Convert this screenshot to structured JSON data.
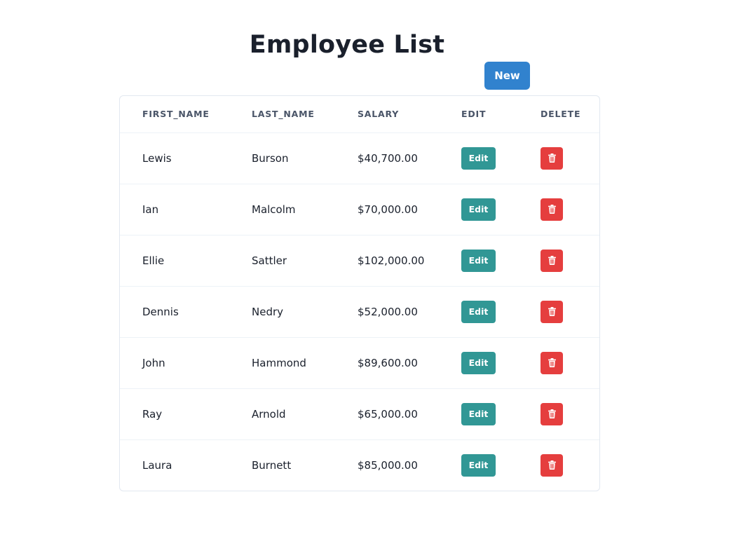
{
  "page": {
    "title": "Employee List",
    "new_label": "New"
  },
  "table": {
    "headers": [
      "FIRST_NAME",
      "LAST_NAME",
      "SALARY",
      "EDIT",
      "DELETE"
    ],
    "edit_label": "Edit",
    "delete_icon": "trash-icon",
    "rows": [
      {
        "first_name": "Lewis",
        "last_name": "Burson",
        "salary": "$40,700.00"
      },
      {
        "first_name": "Ian",
        "last_name": "Malcolm",
        "salary": "$70,000.00"
      },
      {
        "first_name": "Ellie",
        "last_name": "Sattler",
        "salary": "$102,000.00"
      },
      {
        "first_name": "Dennis",
        "last_name": "Nedry",
        "salary": "$52,000.00"
      },
      {
        "first_name": "John",
        "last_name": "Hammond",
        "salary": "$89,600.00"
      },
      {
        "first_name": "Ray",
        "last_name": "Arnold",
        "salary": "$65,000.00"
      },
      {
        "first_name": "Laura",
        "last_name": "Burnett",
        "salary": "$85,000.00"
      }
    ]
  },
  "colors": {
    "new_button": "#3182ce",
    "edit_button": "#319795",
    "delete_button": "#e53e3e",
    "title_text": "#1a202c",
    "header_text": "#4a5568"
  }
}
